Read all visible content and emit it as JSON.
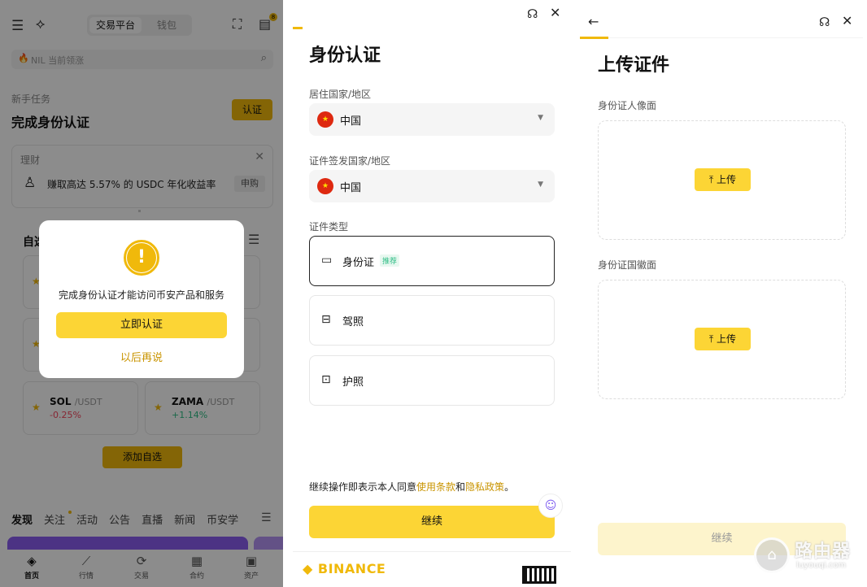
{
  "panel1": {
    "segment": {
      "active": "交易平台",
      "inactive": "钱包"
    },
    "badge_count": "8",
    "search_placeholder": "NIL 当前领涨",
    "task": {
      "label": "新手任务",
      "title": "完成身份认证",
      "button": "认证"
    },
    "finance": {
      "label": "理财",
      "text": "赚取高达 5.57% 的 USDC 年化收益率",
      "button": "申购"
    },
    "watchlist": {
      "label": "自选",
      "tiles": [
        {
          "base": "SOL",
          "quote": "/USDT",
          "change": "-0.25%",
          "color": "#f6465d"
        },
        {
          "base": "ZAMA",
          "quote": "/USDT",
          "change": "+1.14%",
          "color": "#2ebd85"
        }
      ],
      "add_button": "添加自选"
    },
    "tabs": [
      "发现",
      "关注",
      "活动",
      "公告",
      "直播",
      "新闻",
      "币安学"
    ],
    "nav": [
      "首页",
      "行情",
      "交易",
      "合约",
      "资产"
    ],
    "modal": {
      "icon": "!",
      "message": "完成身份认证才能访问币安产品和服务",
      "primary": "立即认证",
      "secondary": "以后再说"
    }
  },
  "panel2": {
    "title": "身份认证",
    "residence_label": "居住国家/地区",
    "residence_value": "中国",
    "issuer_label": "证件签发国家/地区",
    "issuer_value": "中国",
    "doc_type_label": "证件类型",
    "docs": [
      {
        "label": "身份证",
        "tag": "推荐"
      },
      {
        "label": "驾照",
        "tag": ""
      },
      {
        "label": "护照",
        "tag": ""
      }
    ],
    "agreement_prefix": "继续操作即表示本人同意",
    "terms": "使用条款",
    "and": "和",
    "privacy": "隐私政策",
    "period": "。",
    "continue": "继续",
    "brand": "BINANCE"
  },
  "panel3": {
    "title": "上传证件",
    "front_label": "身份证人像面",
    "back_label": "身份证国徽面",
    "upload": "上传",
    "continue": "继续"
  },
  "watermark": {
    "main": "路由器",
    "sub": "luyouqi.com"
  },
  "colors": {
    "accent": "#fcd535",
    "brand": "#f0b90b",
    "down": "#f6465d",
    "up": "#2ebd85"
  }
}
